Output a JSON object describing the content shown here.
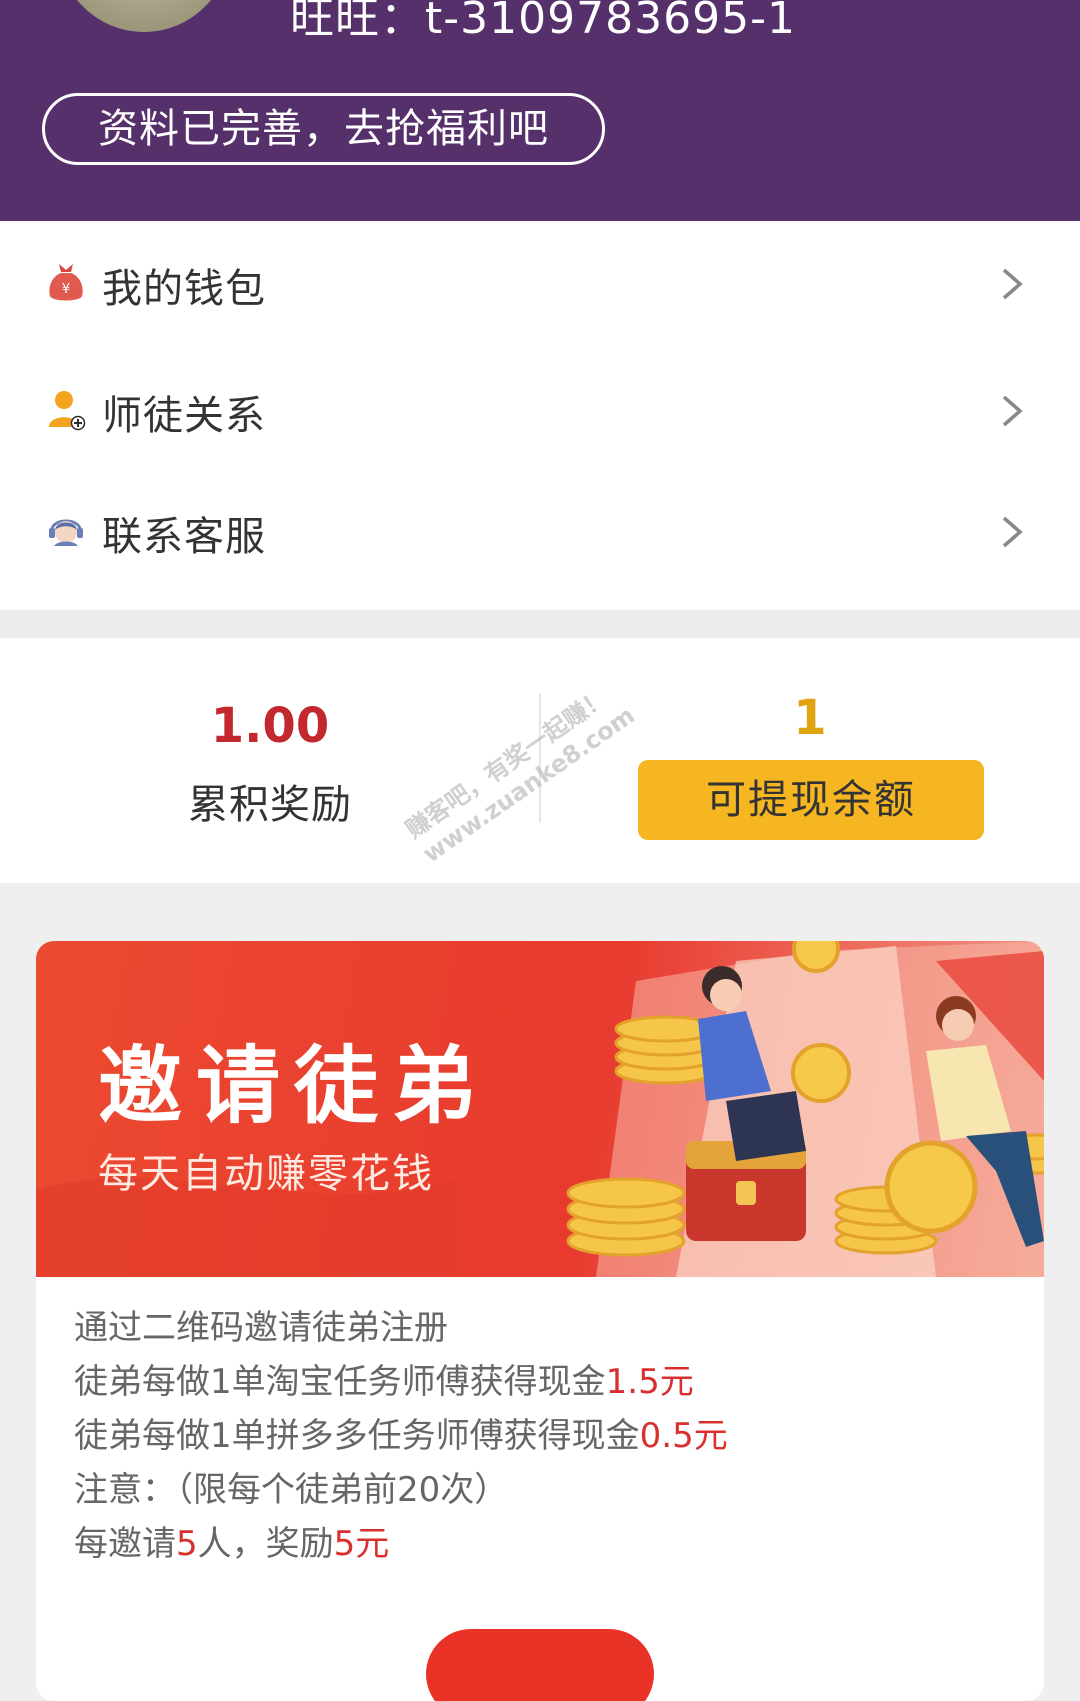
{
  "header": {
    "wangwang": "旺旺：t-3109783695-1",
    "complete_label": "资料已完善，去抢福利吧",
    "bg_color": "#56306a"
  },
  "menu": {
    "items": [
      {
        "label": "我的钱包",
        "icon": "money-bag-icon"
      },
      {
        "label": "师徒关系",
        "icon": "person-add-icon"
      },
      {
        "label": "联系客服",
        "icon": "customer-service-icon"
      }
    ]
  },
  "stats": {
    "accumulated_value": "1.00",
    "accumulated_label": "累积奖励",
    "withdrawable_value": "1",
    "withdraw_label": "可提现余额",
    "accent_red": "#c4282f",
    "accent_yellow": "#f5b622"
  },
  "watermark": {
    "line1": "赚客吧，有奖一起赚！",
    "line2": "www.zuanke8.com"
  },
  "invite": {
    "title": "邀请徒弟",
    "subtitle": "每天自动赚零花钱",
    "rules": [
      {
        "text": "通过二维码邀请徒弟注册"
      },
      {
        "text": "徒弟每做1单淘宝任务师傅获得现金",
        "highlight": "1.5元"
      },
      {
        "text": "徒弟每做1单拼多多任务师傅获得现金",
        "highlight": "0.5元"
      },
      {
        "text": "注意：（限每个徒弟前20次）"
      },
      {
        "prefix": "每邀请",
        "num1": "5",
        "middle": "人，奖励",
        "num2": "5元"
      }
    ],
    "highlight_color": "#d9302f"
  }
}
